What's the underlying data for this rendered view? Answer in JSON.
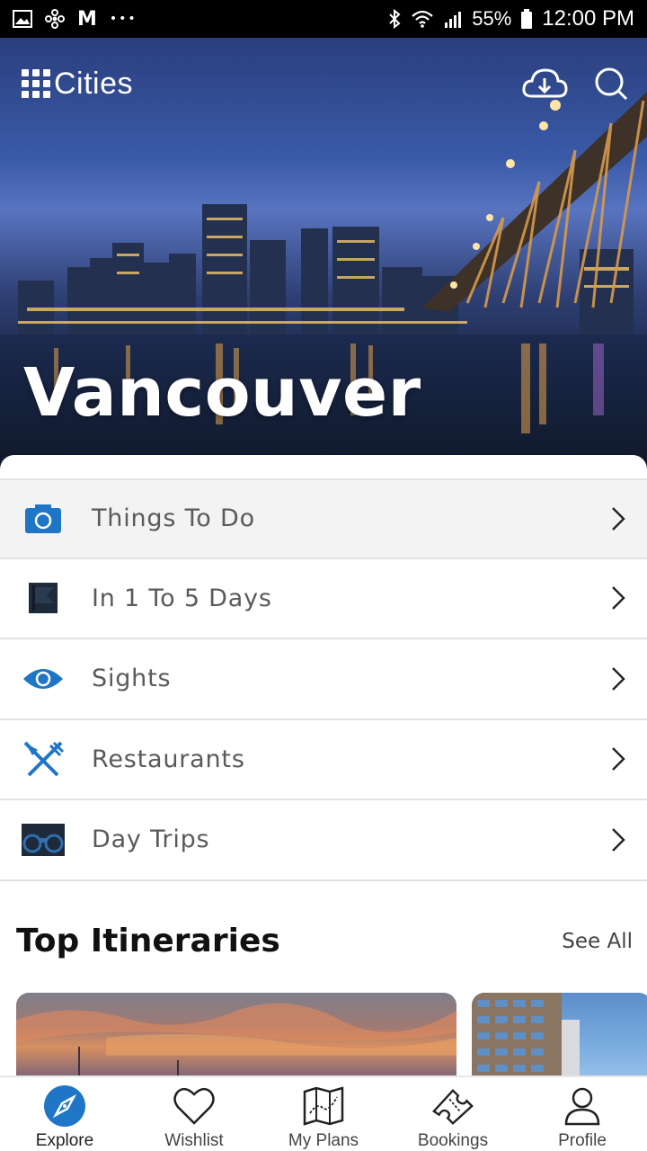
{
  "status_bar": {
    "battery": "55%",
    "time": "12:00 PM",
    "carrier_glyph": "M",
    "dots": "•••"
  },
  "header": {
    "app_name": "Cities",
    "download_icon": "cloud-download-icon",
    "search_icon": "search-icon"
  },
  "hero": {
    "city": "Vancouver"
  },
  "menu": {
    "items": [
      {
        "label": "Things To Do",
        "icon": "camera-icon",
        "active": true
      },
      {
        "label": "In 1 To 5 Days",
        "icon": "flag-icon",
        "active": false
      },
      {
        "label": "Sights",
        "icon": "eye-icon",
        "active": false
      },
      {
        "label": "Restaurants",
        "icon": "fork-knife-icon",
        "active": false
      },
      {
        "label": "Day Trips",
        "icon": "binoculars-icon",
        "active": false
      }
    ]
  },
  "itineraries": {
    "title": "Top Itineraries",
    "see_all": "See All"
  },
  "bottom_nav": {
    "items": [
      {
        "label": "Explore",
        "icon": "compass-icon",
        "active": true
      },
      {
        "label": "Wishlist",
        "icon": "heart-icon",
        "active": false
      },
      {
        "label": "My Plans",
        "icon": "map-icon",
        "active": false
      },
      {
        "label": "Bookings",
        "icon": "ticket-icon",
        "active": false
      },
      {
        "label": "Profile",
        "icon": "profile-icon",
        "active": false
      }
    ]
  },
  "colors": {
    "accent": "#1f76c7",
    "icon_dark": "#1e2a3a",
    "text_muted": "#5a5a5a"
  }
}
